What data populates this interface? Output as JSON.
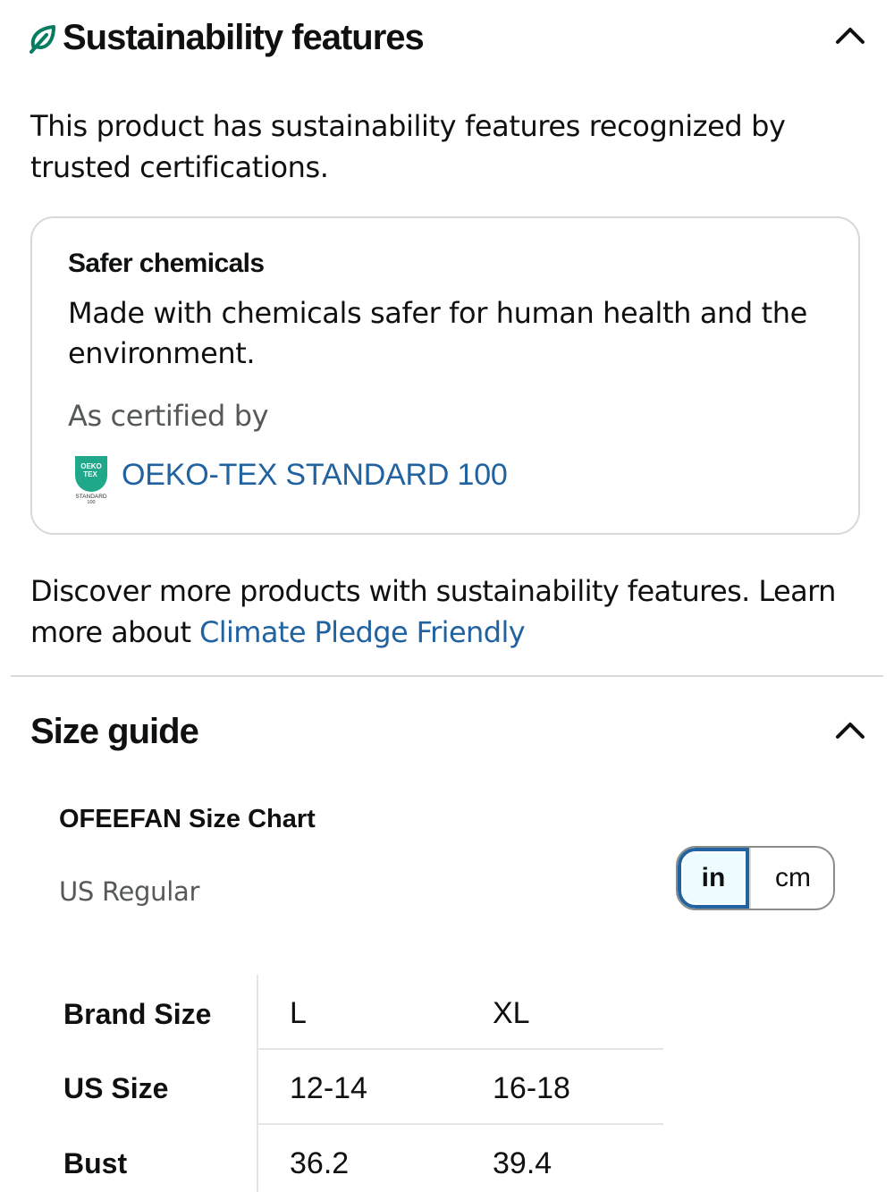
{
  "sustainability": {
    "title": "Sustainability features",
    "intro": "This product has sustainability features recognized by trusted certifications.",
    "feature": {
      "title": "Safer chemicals",
      "description": "Made with chemicals safer for human health and the environment.",
      "certified_label": "As certified by",
      "certification": "OEKO-TEX STANDARD 100",
      "logo_text": [
        "OEKO",
        "TEX",
        "STANDARD",
        "100"
      ]
    },
    "discover_text": "Discover more products with sustainability features. Learn more about ",
    "discover_link": "Climate Pledge Friendly"
  },
  "size_guide": {
    "title": "Size guide",
    "chart_title": "OFEEFAN Size Chart",
    "subtitle": "US Regular",
    "units": {
      "in": "in",
      "cm": "cm",
      "selected": "in"
    },
    "table": {
      "rows": [
        {
          "label": "Brand Size",
          "values": [
            "L",
            "XL"
          ]
        },
        {
          "label": "US Size",
          "values": [
            "12-14",
            "16-18"
          ]
        },
        {
          "label": "Bust",
          "values": [
            "36.2",
            "39.4"
          ]
        }
      ]
    }
  },
  "icons": {
    "leaf": "leaf-icon",
    "collapse": "chevron-up-icon"
  },
  "colors": {
    "link": "#2162a1",
    "leaf": "#067d62",
    "oeko_green": "#1fa98a",
    "border": "#d5d9d9",
    "muted_text": "#565959"
  }
}
